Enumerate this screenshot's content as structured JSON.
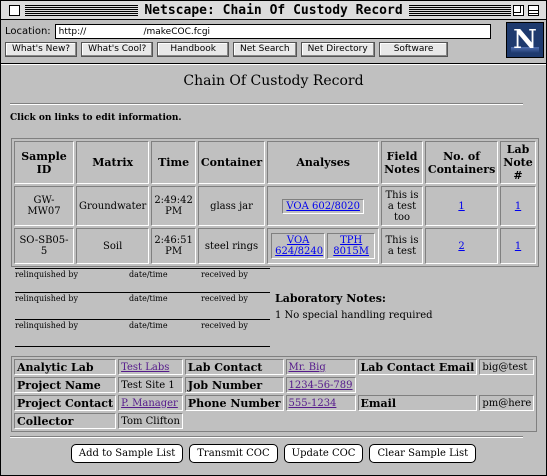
{
  "window": {
    "title": "Netscape: Chain Of Custody Record"
  },
  "toolbar": {
    "location_label": "Location:",
    "location_value": "http://                    /makeCOC.fcgi",
    "directory_buttons": [
      "What's New?",
      "What's Cool?",
      "Handbook",
      "Net Search",
      "Net Directory",
      "Software"
    ],
    "logo_letter": "N"
  },
  "page": {
    "title": "Chain Of Custody Record",
    "instruction": "Click on links to edit information."
  },
  "samples_table": {
    "headers": [
      "Sample ID",
      "Matrix",
      "Time",
      "Container",
      "Analyses",
      "Field Notes",
      "No. of Containers",
      "Lab Note #"
    ],
    "rows": [
      {
        "sample_id": "GW-MW07",
        "matrix": "Groundwater",
        "time": "2:49:42 PM",
        "container": "glass jar",
        "analyses": [
          "VOA 602/8020"
        ],
        "field_notes": "This is a test too",
        "containers": "1",
        "lab_note": "1"
      },
      {
        "sample_id": "SO-SB05-5",
        "matrix": "Soil",
        "time": "2:46:51 PM",
        "container": "steel rings",
        "analyses": [
          "VOA 624/8240",
          "TPH 8015M"
        ],
        "field_notes": "This is a test",
        "containers": "2",
        "lab_note": "1"
      }
    ]
  },
  "signatures": {
    "relinquished_by": "relinquished by",
    "date_time": "date/time",
    "received_by": "received by"
  },
  "lab_notes": {
    "heading": "Laboratory Notes:",
    "note": "1 No special handling required"
  },
  "info": {
    "analytic_lab_label": "Analytic Lab",
    "analytic_lab": "Test Labs",
    "lab_contact_label": "Lab Contact",
    "lab_contact": "Mr. Big",
    "lab_contact_email_label": "Lab Contact Email",
    "lab_contact_email": "big@test",
    "project_name_label": "Project Name",
    "project_name": "Test Site 1",
    "job_number_label": "Job Number",
    "job_number": "1234-56-789",
    "project_contact_label": "Project Contact",
    "project_contact": "P. Manager",
    "phone_number_label": "Phone Number",
    "phone_number": "555-1234",
    "email_label": "Email",
    "email": "pm@here",
    "collector_label": "Collector",
    "collector": "Tom Clifton"
  },
  "buttons": {
    "add": "Add to Sample List",
    "transmit": "Transmit COC",
    "update": "Update COC",
    "clear": "Clear Sample List"
  }
}
